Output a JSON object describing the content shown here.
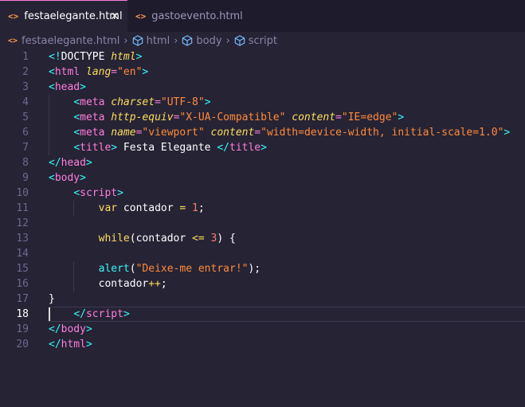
{
  "tabs": [
    {
      "icon": "<>",
      "label": "festaelegante.html",
      "active": true,
      "close": "✕"
    },
    {
      "icon": "<>",
      "label": "gastoevento.html",
      "active": false
    }
  ],
  "breadcrumb": {
    "file": "festaelegante.html",
    "items": [
      "html",
      "body",
      "script"
    ],
    "separator": "›"
  },
  "editor": {
    "current_line": 18,
    "lines": [
      {
        "n": "1",
        "tokens": [
          [
            "br",
            "<!"
          ],
          [
            "txt",
            "DOCTYPE "
          ],
          [
            "doc",
            "html"
          ],
          [
            "br",
            ">"
          ]
        ]
      },
      {
        "n": "2",
        "tokens": [
          [
            "br",
            "<"
          ],
          [
            "tag",
            "html"
          ],
          [
            "txt",
            " "
          ],
          [
            "attr",
            "lang"
          ],
          [
            "eq",
            "="
          ],
          [
            "str",
            "\"en\""
          ],
          [
            "br",
            ">"
          ]
        ]
      },
      {
        "n": "3",
        "tokens": [
          [
            "br",
            "<"
          ],
          [
            "tag",
            "head"
          ],
          [
            "br",
            ">"
          ]
        ]
      },
      {
        "n": "4",
        "tokens": [
          [
            "txt",
            "    "
          ],
          [
            "br",
            "<"
          ],
          [
            "tag",
            "meta"
          ],
          [
            "txt",
            " "
          ],
          [
            "attr",
            "charset"
          ],
          [
            "eq",
            "="
          ],
          [
            "str",
            "\"UTF-8\""
          ],
          [
            "br",
            ">"
          ]
        ]
      },
      {
        "n": "5",
        "tokens": [
          [
            "txt",
            "    "
          ],
          [
            "br",
            "<"
          ],
          [
            "tag",
            "meta"
          ],
          [
            "txt",
            " "
          ],
          [
            "attr",
            "http-equiv"
          ],
          [
            "eq",
            "="
          ],
          [
            "str",
            "\"X-UA-Compatible\""
          ],
          [
            "txt",
            " "
          ],
          [
            "attr",
            "content"
          ],
          [
            "eq",
            "="
          ],
          [
            "str",
            "\"IE=edge\""
          ],
          [
            "br",
            ">"
          ]
        ]
      },
      {
        "n": "6",
        "tokens": [
          [
            "txt",
            "    "
          ],
          [
            "br",
            "<"
          ],
          [
            "tag",
            "meta"
          ],
          [
            "txt",
            " "
          ],
          [
            "attr",
            "name"
          ],
          [
            "eq",
            "="
          ],
          [
            "str",
            "\"viewport\""
          ],
          [
            "txt",
            " "
          ],
          [
            "attr",
            "content"
          ],
          [
            "eq",
            "="
          ],
          [
            "str",
            "\"width=device-width, initial-scale=1.0\""
          ],
          [
            "br",
            ">"
          ]
        ]
      },
      {
        "n": "7",
        "tokens": [
          [
            "txt",
            "    "
          ],
          [
            "br",
            "<"
          ],
          [
            "tag",
            "title"
          ],
          [
            "br",
            ">"
          ],
          [
            "txt",
            " Festa Elegante "
          ],
          [
            "br",
            "</"
          ],
          [
            "tag",
            "title"
          ],
          [
            "br",
            ">"
          ]
        ]
      },
      {
        "n": "8",
        "tokens": [
          [
            "br",
            "</"
          ],
          [
            "tag",
            "head"
          ],
          [
            "br",
            ">"
          ]
        ]
      },
      {
        "n": "9",
        "tokens": [
          [
            "br",
            "<"
          ],
          [
            "tag",
            "body"
          ],
          [
            "br",
            ">"
          ]
        ]
      },
      {
        "n": "10",
        "tokens": [
          [
            "txt",
            "    "
          ],
          [
            "br",
            "<"
          ],
          [
            "tag",
            "script"
          ],
          [
            "br",
            ">"
          ]
        ]
      },
      {
        "n": "11",
        "tokens": [
          [
            "txt",
            "        "
          ],
          [
            "kw",
            "var"
          ],
          [
            "txt",
            " contador "
          ],
          [
            "op",
            "="
          ],
          [
            "txt",
            " "
          ],
          [
            "num",
            "1"
          ],
          [
            "txt",
            ";"
          ]
        ]
      },
      {
        "n": "12",
        "tokens": []
      },
      {
        "n": "13",
        "tokens": [
          [
            "txt",
            "        "
          ],
          [
            "kw",
            "while"
          ],
          [
            "txt",
            "(contador "
          ],
          [
            "op",
            "<="
          ],
          [
            "txt",
            " "
          ],
          [
            "num",
            "3"
          ],
          [
            "txt",
            ") {"
          ]
        ]
      },
      {
        "n": "14",
        "tokens": []
      },
      {
        "n": "15",
        "tokens": [
          [
            "txt",
            "        "
          ],
          [
            "fn",
            "alert"
          ],
          [
            "txt",
            "("
          ],
          [
            "str",
            "\"Deixe-me entrar!\""
          ],
          [
            "txt",
            ");"
          ]
        ]
      },
      {
        "n": "16",
        "tokens": [
          [
            "txt",
            "        contador"
          ],
          [
            "op",
            "++"
          ],
          [
            "txt",
            ";"
          ]
        ]
      },
      {
        "n": "17",
        "tokens": [
          [
            "txt",
            "}"
          ]
        ]
      },
      {
        "n": "18",
        "tokens": [
          [
            "txt",
            "    "
          ],
          [
            "br",
            "</"
          ],
          [
            "tag",
            "script"
          ],
          [
            "br",
            ">"
          ]
        ]
      },
      {
        "n": "19",
        "tokens": [
          [
            "br",
            "</"
          ],
          [
            "tag",
            "body"
          ],
          [
            "br",
            ">"
          ]
        ]
      },
      {
        "n": "20",
        "tokens": [
          [
            "br",
            "</"
          ],
          [
            "tag",
            "html"
          ],
          [
            "br",
            ">"
          ]
        ]
      }
    ]
  },
  "colors": {
    "background": "#262335",
    "tabbar": "#1e1b2c",
    "tag": "#ff7edb",
    "bracket": "#36f9f6",
    "attribute": "#fede5d",
    "string": "#ff8b39",
    "number": "#f97e72",
    "text": "#ffffff"
  }
}
